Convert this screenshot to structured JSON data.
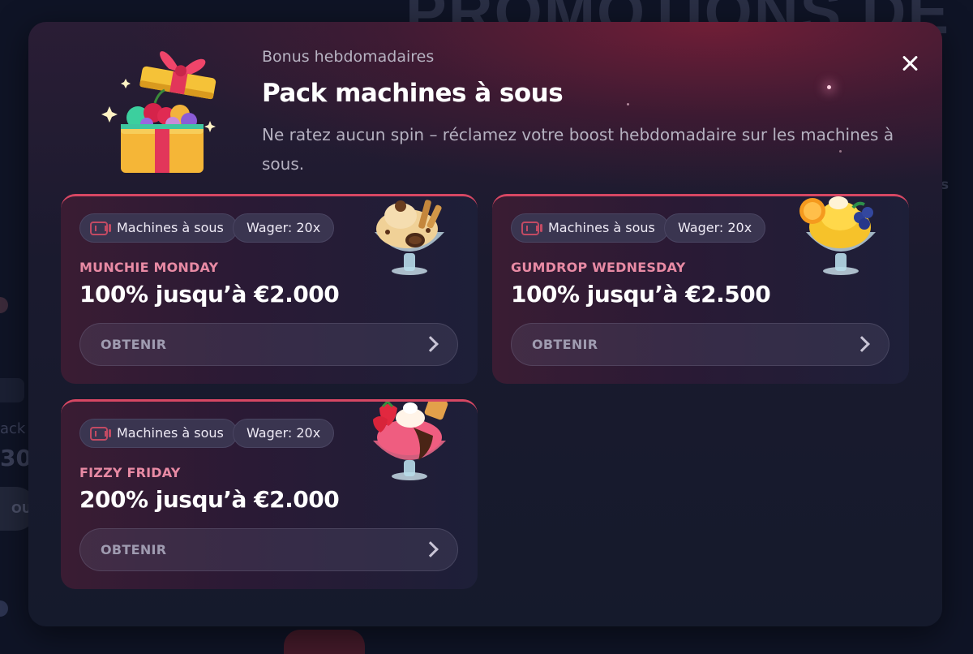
{
  "background": {
    "title": "PROMOTIONS DE",
    "fragment_s": "s",
    "fragment_pack": "ack",
    "fragment_num": "30",
    "fragment_btn": "OU"
  },
  "header": {
    "kicker": "Bonus hebdomadaires",
    "title": "Pack machines à sous",
    "description": "Ne ratez aucun spin – réclamez votre boost hebdomadaire sur les machines à sous."
  },
  "close_icon": "close-icon",
  "cards": [
    {
      "type_tag": "Machines à sous",
      "wager_tag": "Wager: 20x",
      "day": "MUNCHIE MONDAY",
      "amount": "100% jusqu’à €2.000",
      "button": "OBTENIR",
      "image": "chocolate-sundae-icon"
    },
    {
      "type_tag": "Machines à sous",
      "wager_tag": "Wager: 20x",
      "day": "GUMDROP WEDNESDAY",
      "amount": "100% jusqu’à €2.500",
      "button": "OBTENIR",
      "image": "lemon-sundae-icon"
    },
    {
      "type_tag": "Machines à sous",
      "wager_tag": "Wager: 20x",
      "day": "FIZZY FRIDAY",
      "amount": "200% jusqu’à €2.000",
      "button": "OBTENIR",
      "image": "strawberry-sundae-icon"
    }
  ],
  "colors": {
    "accent": "#d64763",
    "day_label": "#e88aa4",
    "modal_bg": "#1a1a2e"
  }
}
